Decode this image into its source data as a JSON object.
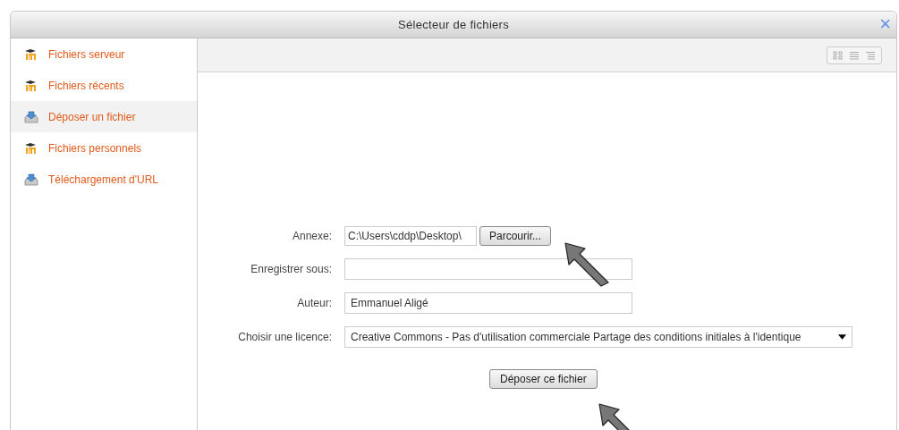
{
  "window": {
    "title": "Sélecteur de fichiers",
    "close": "×"
  },
  "sidebar": {
    "items": [
      {
        "label": "Fichiers serveur",
        "kind": "moodle",
        "selected": false
      },
      {
        "label": "Fichiers récents",
        "kind": "moodle",
        "selected": false
      },
      {
        "label": "Déposer un fichier",
        "kind": "upload",
        "selected": true
      },
      {
        "label": "Fichiers personnels",
        "kind": "moodle",
        "selected": false
      },
      {
        "label": "Téléchargement d'URL",
        "kind": "upload",
        "selected": false
      }
    ]
  },
  "toolbar": {
    "view_modes": [
      {
        "kind": "icons",
        "selected": false
      },
      {
        "kind": "list",
        "selected": false
      },
      {
        "kind": "tree",
        "selected": false
      }
    ]
  },
  "form": {
    "fields": [
      {
        "label": "Annexe:",
        "kind": "file",
        "value": "C:\\Users\\cddp\\Desktop\\",
        "button": "Parcourir..."
      },
      {
        "label": "Enregistrer sous:",
        "kind": "text"
      },
      {
        "label": "Auteur:",
        "kind": "text",
        "value": "Emmanuel Aligé"
      },
      {
        "label": "Choisir une licence:",
        "kind": "select",
        "value": "Creative Commons - Pas d'utilisation commerciale Partage des conditions initiales à l'identique"
      }
    ],
    "submit": "Déposer ce fichier"
  },
  "annotations": [
    {
      "kind": "arrow"
    },
    {
      "kind": "arrow"
    }
  ]
}
